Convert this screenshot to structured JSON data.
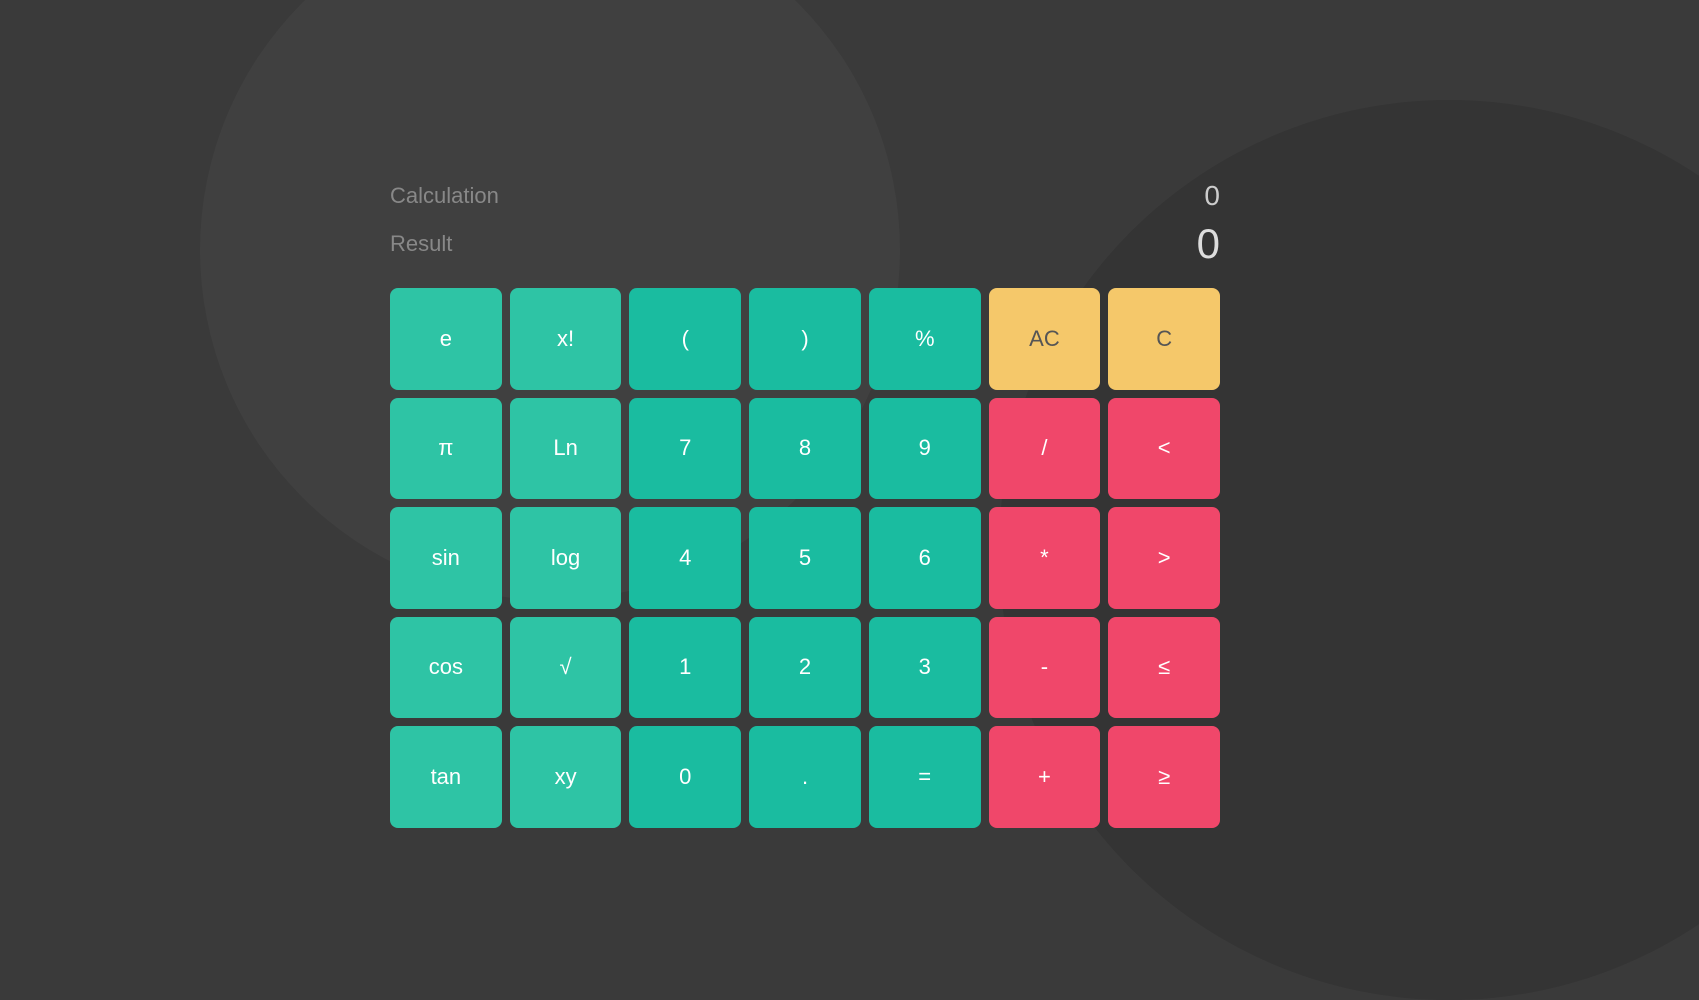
{
  "display": {
    "calculation_label": "Calculation",
    "result_label": "Result",
    "calculation_value": "0",
    "result_value": "0"
  },
  "buttons": [
    {
      "label": "e",
      "type": "green",
      "name": "btn-e"
    },
    {
      "label": "x!",
      "type": "green",
      "name": "btn-factorial"
    },
    {
      "label": "(",
      "type": "teal",
      "name": "btn-open-paren"
    },
    {
      "label": ")",
      "type": "teal",
      "name": "btn-close-paren"
    },
    {
      "label": "%",
      "type": "teal",
      "name": "btn-percent"
    },
    {
      "label": "AC",
      "type": "yellow",
      "name": "btn-ac"
    },
    {
      "label": "C",
      "type": "yellow",
      "name": "btn-c"
    },
    {
      "label": "π",
      "type": "green",
      "name": "btn-pi"
    },
    {
      "label": "Ln",
      "type": "green",
      "name": "btn-ln"
    },
    {
      "label": "7",
      "type": "teal",
      "name": "btn-7"
    },
    {
      "label": "8",
      "type": "teal",
      "name": "btn-8"
    },
    {
      "label": "9",
      "type": "teal",
      "name": "btn-9"
    },
    {
      "label": "/",
      "type": "red",
      "name": "btn-divide"
    },
    {
      "label": "<",
      "type": "red",
      "name": "btn-less-than"
    },
    {
      "label": "sin",
      "type": "green",
      "name": "btn-sin"
    },
    {
      "label": "log",
      "type": "green",
      "name": "btn-log"
    },
    {
      "label": "4",
      "type": "teal",
      "name": "btn-4"
    },
    {
      "label": "5",
      "type": "teal",
      "name": "btn-5"
    },
    {
      "label": "6",
      "type": "teal",
      "name": "btn-6"
    },
    {
      "label": "*",
      "type": "red",
      "name": "btn-multiply"
    },
    {
      "label": ">",
      "type": "red",
      "name": "btn-greater-than"
    },
    {
      "label": "cos",
      "type": "green",
      "name": "btn-cos"
    },
    {
      "label": "√",
      "type": "green",
      "name": "btn-sqrt"
    },
    {
      "label": "1",
      "type": "teal",
      "name": "btn-1"
    },
    {
      "label": "2",
      "type": "teal",
      "name": "btn-2"
    },
    {
      "label": "3",
      "type": "teal",
      "name": "btn-3"
    },
    {
      "label": "-",
      "type": "red",
      "name": "btn-subtract"
    },
    {
      "label": "≤",
      "type": "red",
      "name": "btn-lte"
    },
    {
      "label": "tan",
      "type": "green",
      "name": "btn-tan"
    },
    {
      "label": "xy",
      "type": "green",
      "name": "btn-xy"
    },
    {
      "label": "0",
      "type": "teal",
      "name": "btn-0"
    },
    {
      "label": ".",
      "type": "teal",
      "name": "btn-dot"
    },
    {
      "label": "=",
      "type": "teal",
      "name": "btn-equals"
    },
    {
      "label": "+",
      "type": "red",
      "name": "btn-add"
    },
    {
      "label": "≥",
      "type": "red",
      "name": "btn-gte"
    }
  ],
  "colors": {
    "green": "#2ec4a5",
    "teal": "#1abca0",
    "yellow": "#f5c86a",
    "red": "#f0476a"
  }
}
